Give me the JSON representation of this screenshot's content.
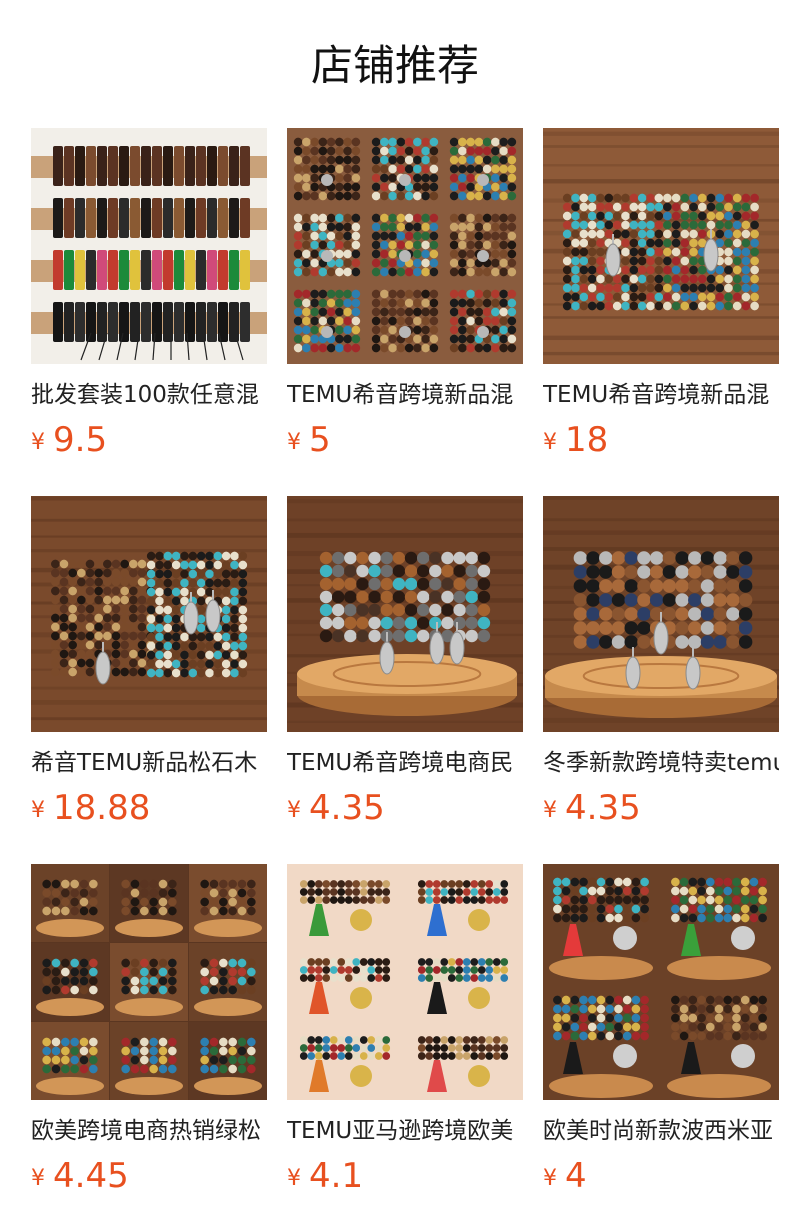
{
  "section": {
    "title": "店铺推荐"
  },
  "currency_symbol": "¥",
  "products": [
    {
      "name": "批发套装100款任意混",
      "price": "9.5",
      "image": "leather-cuff-bracelets-on-rods"
    },
    {
      "name": "TEMU希音跨境新品混",
      "price": "5",
      "image": "beaded-bracelet-stacks-display"
    },
    {
      "name": "TEMU希音跨境新品混",
      "price": "18",
      "image": "beaded-bracelet-stacks-on-wood"
    },
    {
      "name": "希音TEMU新品松石木",
      "price": "18.88",
      "image": "turquoise-wood-bead-stacks"
    },
    {
      "name": "TEMU希音跨境电商民",
      "price": "4.35",
      "image": "feather-charm-bracelets"
    },
    {
      "name": "冬季新款跨境特卖temu",
      "price": "4.35",
      "image": "leaf-charm-wood-bracelets"
    },
    {
      "name": "欧美跨境电商热销绿松",
      "price": "4.45",
      "image": "nine-bracelet-collage"
    },
    {
      "name": "TEMU亚马逊跨境欧美",
      "price": "4.1",
      "image": "tassel-bracelet-collage"
    },
    {
      "name": "欧美时尚新款波西米亚",
      "price": "4",
      "image": "bohemian-tassel-bracelets"
    }
  ]
}
